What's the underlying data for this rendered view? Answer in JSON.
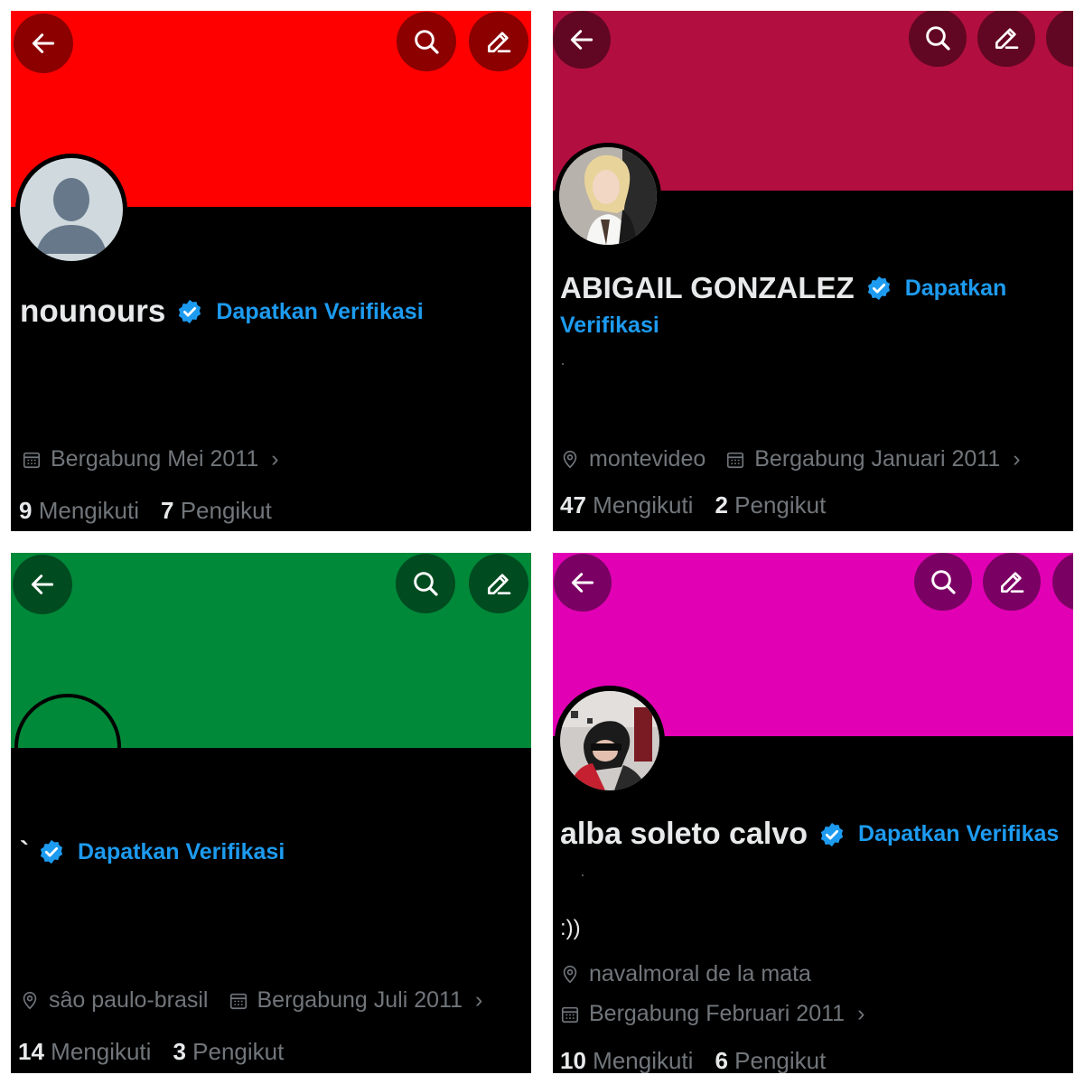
{
  "panels": [
    {
      "banner_color": "#ff0000",
      "name": "nounours",
      "verify_label": "Dapatkan Verifikasi",
      "joined": "Bergabung Mei 2011",
      "following_count": "9",
      "following_label": "Mengikuti",
      "followers_count": "7",
      "followers_label": "Pengikut",
      "avatar": "default-avatar"
    },
    {
      "banner_color": "#b30e40",
      "name": "ABIGAIL GONZALEZ",
      "verify_label_line1": "Dapatkan",
      "verify_label_line2": "Verifikasi",
      "location": "montevideo",
      "joined": "Bergabung Januari 2011",
      "following_count": "47",
      "following_label": "Mengikuti",
      "followers_count": "2",
      "followers_label": "Pengikut",
      "avatar": "photo-blonde-woman"
    },
    {
      "banner_color": "#008939",
      "name": "`",
      "verify_label": "Dapatkan Verifikasi",
      "location": "sâo paulo-brasil",
      "joined": "Bergabung Juli 2011",
      "following_count": "14",
      "following_label": "Mengikuti",
      "followers_count": "3",
      "followers_label": "Pengikut",
      "avatar": "empty-avatar-ring"
    },
    {
      "banner_color": "#e100b4",
      "name": "alba soleto calvo",
      "verify_label": "Dapatkan Verifikas",
      "bio": ":))",
      "location": "navalmoral de la mata",
      "joined": "Bergabung Februari 2011",
      "following_count": "10",
      "following_label": "Mengikuti",
      "followers_count": "6",
      "followers_label": "Pengikut",
      "avatar": "photo-woman-sunglasses"
    }
  ],
  "icons": {
    "back": "arrow-left-icon",
    "search": "search-icon",
    "edit": "pencil-icon",
    "more": "more-icon",
    "verified": "verified-badge-icon",
    "calendar": "calendar-icon",
    "location": "location-pin-icon",
    "chevron": "›"
  },
  "colors": {
    "verified_blue": "#1d9bf0",
    "muted_text": "#71767b",
    "primary_text": "#e7e9ea",
    "background": "#000000"
  }
}
